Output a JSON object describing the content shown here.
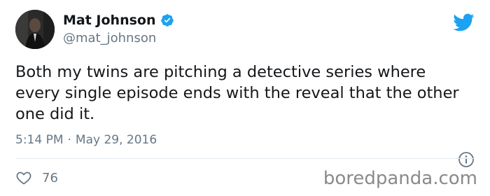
{
  "user": {
    "name": "Mat Johnson",
    "handle": "@mat_johnson",
    "verified": true
  },
  "tweet": {
    "text": "Both my twins are pitching a detective series where every single episode ends with the reveal that the other one did it.",
    "time": "5:14 PM",
    "separator": "·",
    "date": "May 29, 2016",
    "likes": "76"
  },
  "watermark": {
    "text": "boredpanda.com"
  },
  "colors": {
    "twitter_blue": "#1da1f2",
    "secondary_text": "#657786",
    "divider": "#e1e8ed"
  },
  "icons": {
    "brand": "twitter-bird-icon",
    "verified": "verified-badge-icon",
    "info": "info-icon",
    "like": "heart-icon"
  }
}
